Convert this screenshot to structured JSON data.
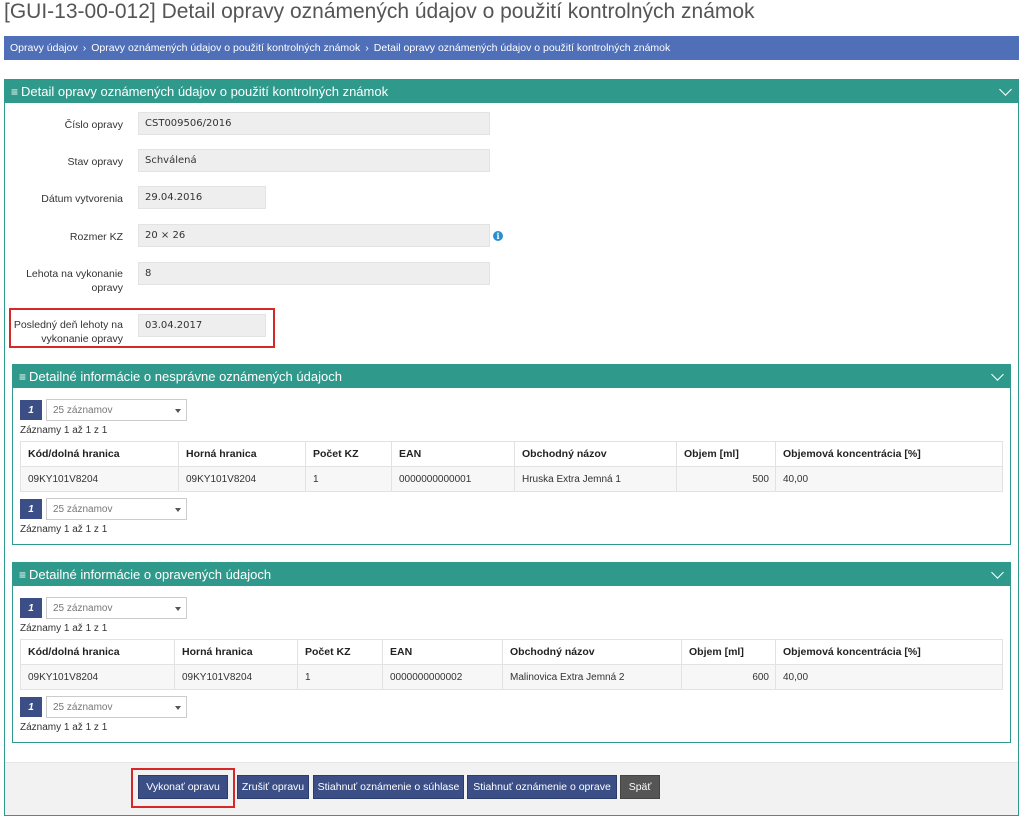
{
  "page": {
    "title": "[GUI-13-00-012] Detail opravy oznámených údajov o použití kontrolných známok"
  },
  "breadcrumb": {
    "items": [
      "Opravy údajov",
      "Opravy oznámených údajov o použití kontrolných známok",
      "Detail opravy oznámených údajov o použití kontrolných známok"
    ],
    "separator": "›"
  },
  "main_panel": {
    "title": "Detail opravy oznámených údajov o použití kontrolných známok",
    "fields": {
      "cislo_opravy": {
        "label": "Číslo opravy",
        "value": "CST009506/2016"
      },
      "stav_opravy": {
        "label": "Stav opravy",
        "value": "Schválená"
      },
      "datum_vytvorenia": {
        "label": "Dátum vytvorenia",
        "value": "29.04.2016"
      },
      "rozmer_kz": {
        "label": "Rozmer KZ",
        "value": "20 × 26"
      },
      "lehota": {
        "label": "Lehota na vykonanie opravy",
        "value": "8"
      },
      "posledny_den": {
        "label": "Posledný deň lehoty na vykonanie opravy",
        "value": "03.04.2017"
      }
    },
    "info_icon_glyph": "i"
  },
  "panel_incorrect": {
    "title": "Detailné informácie o nesprávne oznámených údajoch",
    "page_number": "1",
    "page_size": "25 záznamov",
    "records_text": "Záznamy 1 až 1 z 1",
    "columns": [
      "Kód/dolná hranica",
      "Horná hranica",
      "Počet KZ",
      "EAN",
      "Obchodný názov",
      "Objem [ml]",
      "Objemová koncentrácia [%]"
    ],
    "rows": [
      [
        "09KY101V8204",
        "09KY101V8204",
        "1",
        "0000000000001",
        "Hruska Extra Jemná 1",
        "500",
        "40,00"
      ]
    ]
  },
  "panel_corrected": {
    "title": "Detailné informácie o opravených údajoch",
    "page_number": "1",
    "page_size": "25 záznamov",
    "records_text": "Záznamy 1 až 1 z 1",
    "columns": [
      "Kód/dolná hranica",
      "Horná hranica",
      "Počet KZ",
      "EAN",
      "Obchodný názov",
      "Objem [ml]",
      "Objemová koncentrácia [%]"
    ],
    "rows": [
      [
        "09KY101V8204",
        "09KY101V8204",
        "1",
        "0000000000002",
        "Malinovica Extra Jemná 2",
        "600",
        "40,00"
      ]
    ]
  },
  "buttons": {
    "vykonat": "Vykonať opravu",
    "zrusit": "Zrušiť opravu",
    "stiahnut_suhlas": "Stiahnuť oznámenie o súhlase",
    "stiahnut_oprava": "Stiahnuť oznámenie o oprave",
    "spat": "Späť"
  },
  "colors": {
    "panel_header": "#2f9a8b",
    "breadcrumb": "#4f6fb8",
    "button_primary": "#3b4f86",
    "button_back": "#555555",
    "highlight": "#d62828"
  }
}
